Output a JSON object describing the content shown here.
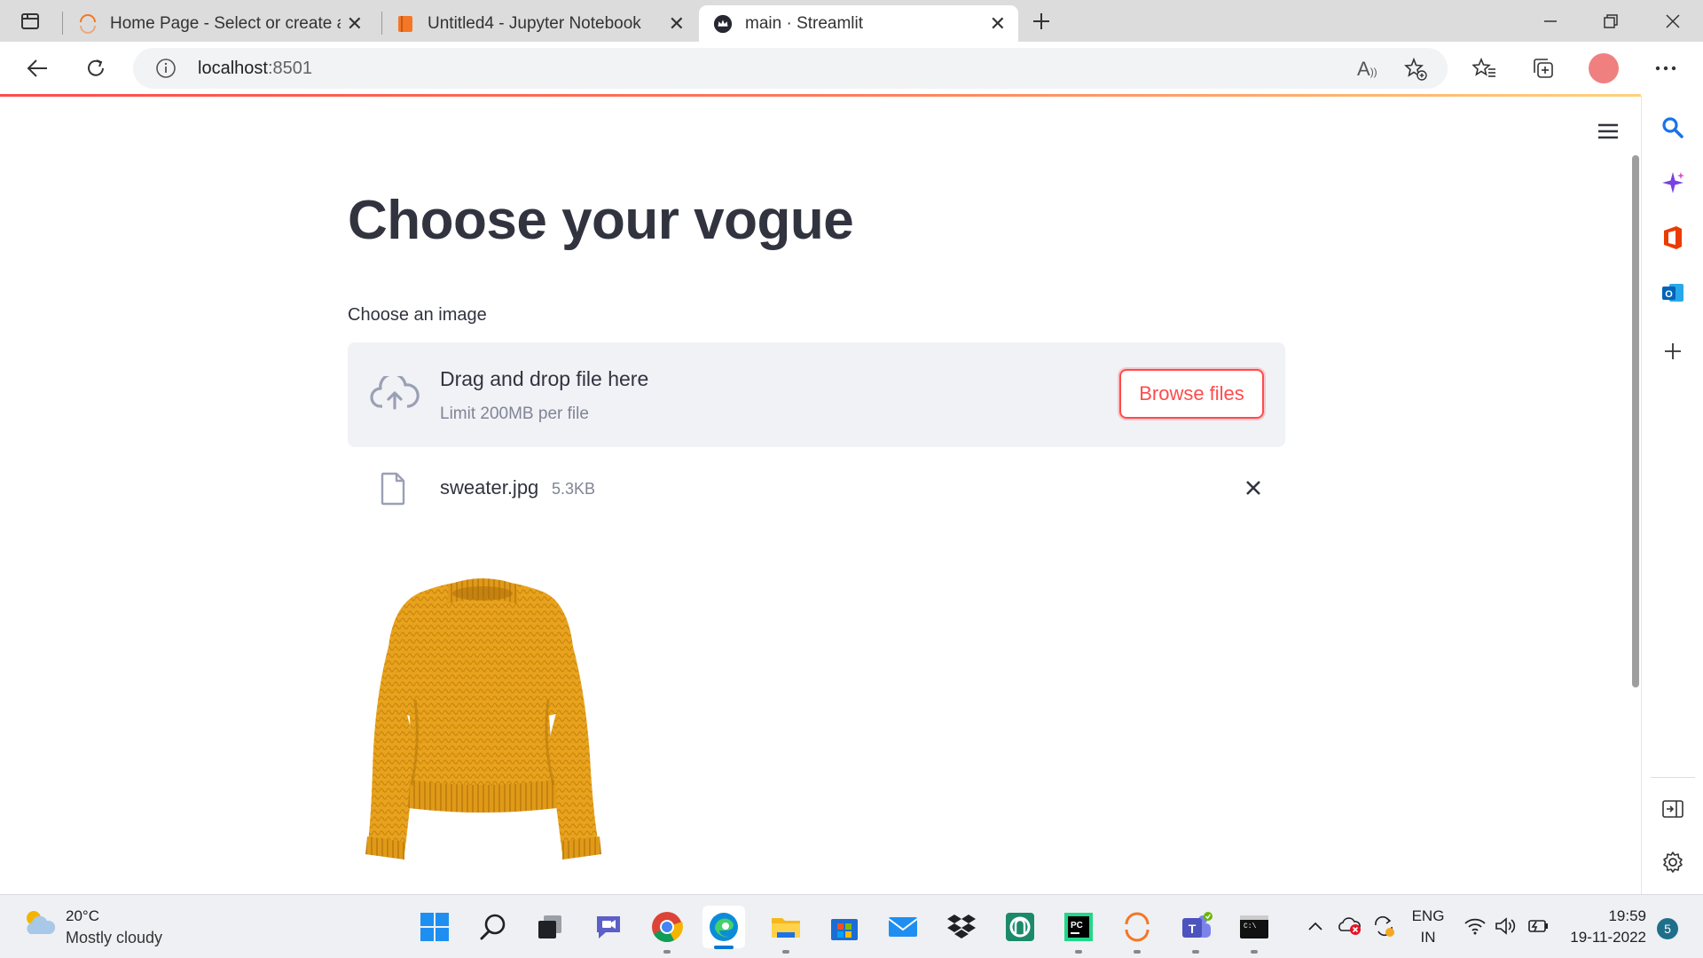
{
  "browser": {
    "tabs": [
      {
        "title": "Home Page - Select or create a new notebook",
        "favicon": "jupyter-loading-icon",
        "active": false
      },
      {
        "title": "Untitled4 - Jupyter Notebook",
        "favicon": "jupyter-book-icon",
        "active": false
      },
      {
        "title": "main · Streamlit",
        "favicon": "streamlit-crown-icon",
        "active": true
      }
    ],
    "address": {
      "host": "localhost",
      "port": ":8501"
    }
  },
  "app": {
    "title": "Choose your vogue",
    "uploader": {
      "label": "Choose an image",
      "drag_text": "Drag and drop file here",
      "limit_text": "Limit 200MB per file",
      "browse_label": "Browse files"
    },
    "file": {
      "name": "sweater.jpg",
      "size": "5.3KB"
    },
    "image": {
      "subject": "mustard knit sweater",
      "color": "#e8a21c"
    },
    "accent": "#ff4b4b"
  },
  "taskbar": {
    "weather": {
      "temp": "20°C",
      "desc": "Mostly cloudy"
    },
    "lang": {
      "line1": "ENG",
      "line2": "IN"
    },
    "clock": {
      "time": "19:59",
      "date": "19-11-2022"
    },
    "notifications": "5"
  }
}
